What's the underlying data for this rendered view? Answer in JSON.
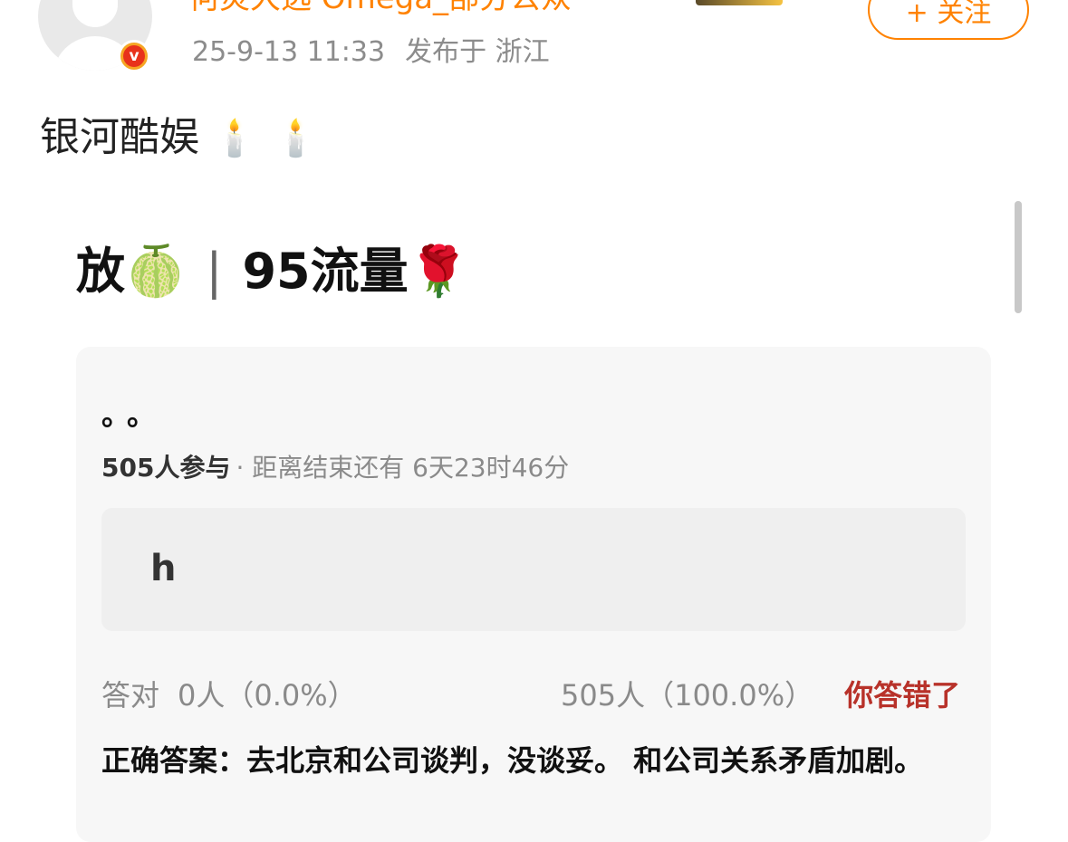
{
  "post": {
    "username": "何炅大选 Omega_部分公众",
    "time": "25-9-13 11:33",
    "location": "发布于 浙江",
    "follow_label": "+ 关注",
    "badge_letter": "v",
    "text": "银河酷娱",
    "candles": "🕯️🕯️"
  },
  "poll": {
    "title_prefix": "放🍈",
    "title_separator": "|",
    "title_main": "95流量🌹",
    "question": "。。",
    "participants": "505人参与",
    "remaining": "· 距离结束还有 6天23时46分",
    "option_label": "h",
    "correct_label": "答对",
    "correct_count": "0人（0.0%）",
    "result_count": "505人（100.0%）",
    "wrong_label": "你答错了",
    "answer": "正确答案：去北京和公司谈判，没谈妥。 和公司关系矛盾加剧。"
  },
  "colors": {
    "accent": "#ff8200",
    "wrong": "#b8322a",
    "card_bg": "#f7f7f7"
  }
}
